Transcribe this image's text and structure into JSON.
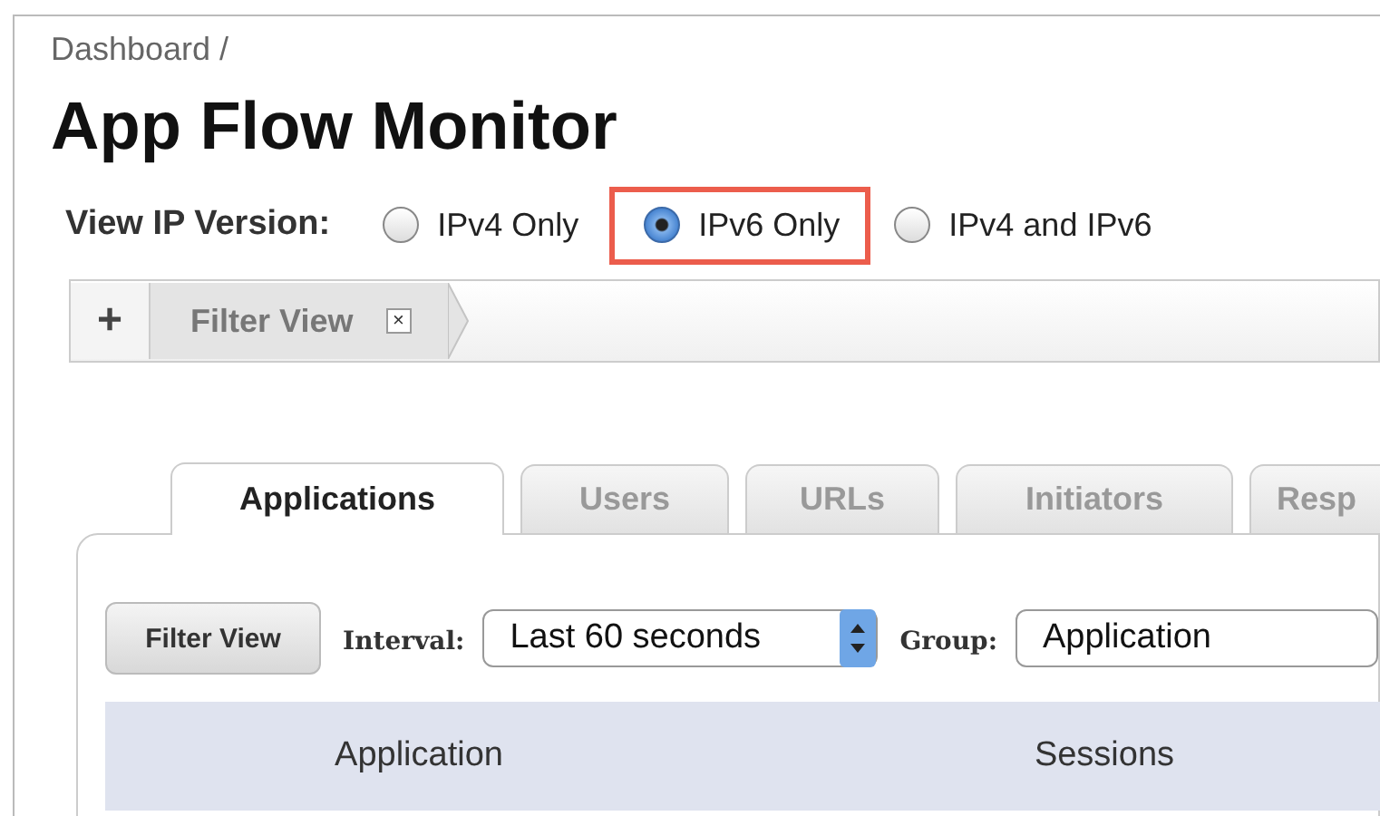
{
  "breadcrumb": "Dashboard /",
  "title": "App Flow Monitor",
  "ip_version": {
    "label": "View IP Version:",
    "options": [
      {
        "label": "IPv4 Only",
        "selected": false
      },
      {
        "label": "IPv6 Only",
        "selected": true
      },
      {
        "label": "IPv4 and IPv6",
        "selected": false
      }
    ]
  },
  "filter_bar": {
    "add": "+",
    "tab": "Filter View",
    "close": "×"
  },
  "tabs": [
    {
      "label": "Applications",
      "selected": true
    },
    {
      "label": "Users",
      "selected": false
    },
    {
      "label": "URLs",
      "selected": false
    },
    {
      "label": "Initiators",
      "selected": false
    },
    {
      "label": "Resp",
      "selected": false
    }
  ],
  "toolbar": {
    "filter_button": "Filter View",
    "interval_label": "Interval:",
    "interval": "Last 60 seconds",
    "group_label": "Group:",
    "group": "Application"
  },
  "table": {
    "columns": [
      "Application",
      "Sessions"
    ]
  }
}
